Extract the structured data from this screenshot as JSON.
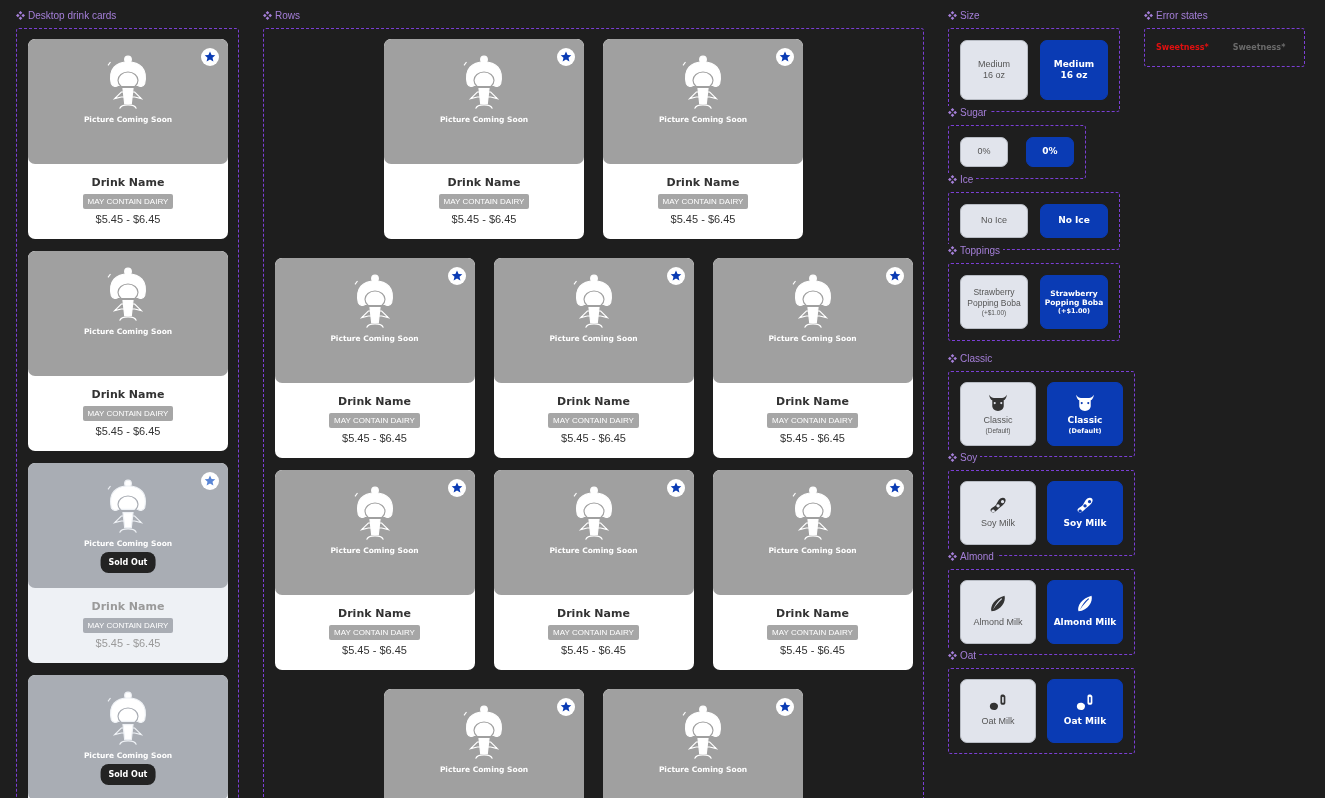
{
  "drink_cards": {
    "title": "Desktop drink cards",
    "cards": [
      {
        "caption": "Picture Coming Soon",
        "name": "Drink Name",
        "allergen": "MAY CONTAIN DAIRY",
        "price": "$5.45 - $6.45",
        "favorite": true,
        "sold_out": false
      },
      {
        "caption": "Picture Coming Soon",
        "name": "Drink Name",
        "allergen": "MAY CONTAIN DAIRY",
        "price": "$5.45 - $6.45",
        "favorite": false,
        "sold_out": false
      },
      {
        "caption": "Picture Coming Soon",
        "badge": "Sold Out",
        "name": "Drink Name",
        "allergen": "MAY CONTAIN DAIRY",
        "price": "$5.45 - $6.45",
        "favorite": true,
        "sold_out": true
      },
      {
        "caption": "Picture Coming Soon",
        "badge": "Sold Out",
        "favorite": false,
        "sold_out": true
      }
    ]
  },
  "rows": {
    "title": "Rows",
    "rows": [
      {
        "cards": [
          {
            "caption": "Picture Coming Soon",
            "name": "Drink Name",
            "allergen": "MAY CONTAIN DAIRY",
            "price": "$5.45 - $6.45",
            "favorite": true,
            "sold_out": false
          },
          {
            "caption": "Picture Coming Soon",
            "name": "Drink Name",
            "allergen": "MAY CONTAIN DAIRY",
            "price": "$5.45 - $6.45",
            "favorite": true,
            "sold_out": false
          }
        ]
      },
      {
        "cards": [
          {
            "caption": "Picture Coming Soon",
            "name": "Drink Name",
            "allergen": "MAY CONTAIN DAIRY",
            "price": "$5.45 - $6.45",
            "favorite": true,
            "sold_out": false
          },
          {
            "caption": "Picture Coming Soon",
            "name": "Drink Name",
            "allergen": "MAY CONTAIN DAIRY",
            "price": "$5.45 - $6.45",
            "favorite": true,
            "sold_out": false
          },
          {
            "caption": "Picture Coming Soon",
            "name": "Drink Name",
            "allergen": "MAY CONTAIN DAIRY",
            "price": "$5.45 - $6.45",
            "favorite": true,
            "sold_out": false
          }
        ]
      },
      {
        "cards": [
          {
            "caption": "Picture Coming Soon",
            "name": "Drink Name",
            "allergen": "MAY CONTAIN DAIRY",
            "price": "$5.45 - $6.45",
            "favorite": true,
            "sold_out": false
          },
          {
            "caption": "Picture Coming Soon",
            "name": "Drink Name",
            "allergen": "MAY CONTAIN DAIRY",
            "price": "$5.45 - $6.45",
            "favorite": true,
            "sold_out": false
          },
          {
            "caption": "Picture Coming Soon",
            "name": "Drink Name",
            "allergen": "MAY CONTAIN DAIRY",
            "price": "$5.45 - $6.45",
            "favorite": true,
            "sold_out": false
          }
        ]
      },
      {
        "cards": [
          {
            "caption": "Picture Coming Soon",
            "favorite": true,
            "sold_out": false
          },
          {
            "caption": "Picture Coming Soon",
            "favorite": true,
            "sold_out": false
          }
        ]
      }
    ]
  },
  "choice_groups": [
    {
      "title": "Size",
      "kind": "size",
      "options": [
        {
          "label": "Medium",
          "detail": "16 oz",
          "selected": false
        },
        {
          "label": "Medium",
          "detail": "16 oz",
          "selected": true
        }
      ]
    },
    {
      "title": "Sugar",
      "kind": "sugar",
      "options": [
        {
          "label": "0%",
          "selected": false
        },
        {
          "label": "0%",
          "selected": true
        }
      ]
    },
    {
      "title": "Ice",
      "kind": "ice",
      "options": [
        {
          "label": "No Ice",
          "selected": false
        },
        {
          "label": "No Ice",
          "selected": true
        }
      ]
    },
    {
      "title": "Toppings",
      "kind": "toppings",
      "options": [
        {
          "label": "Strawberry Popping Boba",
          "detail": "(+$1.00)",
          "selected": false
        },
        {
          "label": "Strawberry Popping Boba",
          "detail": "(+$1.00)",
          "selected": true
        }
      ]
    }
  ],
  "milk_groups": [
    {
      "title": "Classic",
      "kind": "cow",
      "options": [
        {
          "label": "Classic",
          "detail": "(Default)",
          "selected": false
        },
        {
          "label": "Classic",
          "detail": "(Default)",
          "selected": true
        }
      ]
    },
    {
      "title": "Soy",
      "kind": "soy",
      "options": [
        {
          "label": "Soy Milk",
          "selected": false
        },
        {
          "label": "Soy Milk",
          "selected": true
        }
      ]
    },
    {
      "title": "Almond",
      "kind": "almond",
      "options": [
        {
          "label": "Almond Milk",
          "selected": false
        },
        {
          "label": "Almond Milk",
          "selected": true
        }
      ]
    },
    {
      "title": "Oat",
      "kind": "oat",
      "options": [
        {
          "label": "Oat Milk",
          "selected": false
        },
        {
          "label": "Oat Milk",
          "selected": true
        }
      ]
    }
  ],
  "error_states": {
    "title": "Error states",
    "labels": [
      {
        "text": "Sweetness*",
        "error": true
      },
      {
        "text": "Sweetness*",
        "error": false
      }
    ]
  }
}
